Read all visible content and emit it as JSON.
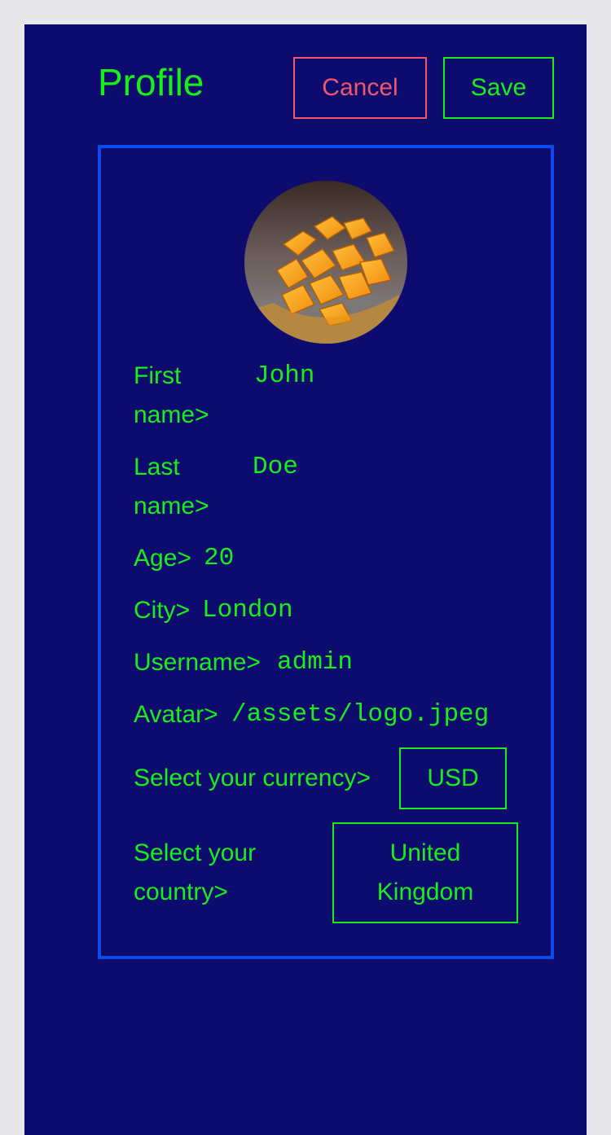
{
  "header": {
    "title": "Profile",
    "cancel_label": "Cancel",
    "save_label": "Save"
  },
  "colors": {
    "background": "#0d0c6e",
    "text": "#1aee1a",
    "card_border": "#0b4cf0",
    "cancel": "#f2566a",
    "outer": "#e8e8ea"
  },
  "profile": {
    "avatar_icon": "mango-photo-avatar",
    "fields": {
      "first_name": {
        "label": "First name>",
        "value": "John"
      },
      "last_name": {
        "label": "Last name>",
        "value": "Doe"
      },
      "age": {
        "label": "Age>",
        "value": "20"
      },
      "city": {
        "label": "City>",
        "value": "London"
      },
      "username": {
        "label": "Username>",
        "value": "admin"
      },
      "avatar": {
        "label": "Avatar>",
        "value": "/assets/logo.jpeg"
      }
    },
    "currency": {
      "label": "Select your currency>",
      "value": "USD"
    },
    "country": {
      "label": "Select your country>",
      "value": "United Kingdom"
    }
  }
}
